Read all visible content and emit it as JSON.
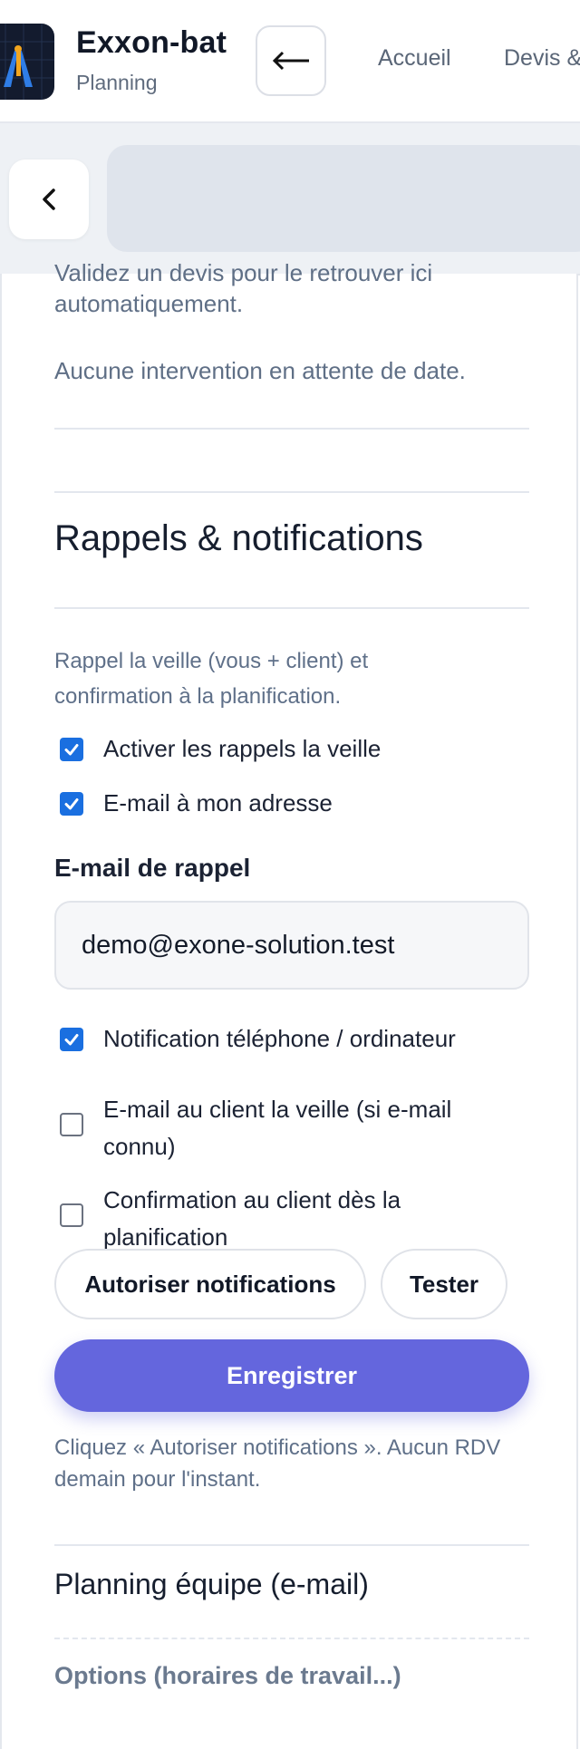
{
  "header": {
    "brand_name": "Exxon-bat",
    "brand_sub": "Planning",
    "back_glyph": "←",
    "nav": [
      "Accueil",
      "Devis &"
    ]
  },
  "subbar": {
    "back_glyph": "‹"
  },
  "pending": {
    "cut_text": "Validez un devis pour le retrouver ici",
    "line2": "automatiquement.",
    "empty_text": "Aucune intervention en attente de date."
  },
  "reminders": {
    "title": "Rappels & notifications",
    "description": "Rappel la veille (vous + client) et confirmation à la planification.",
    "options": [
      {
        "label": "Activer les rappels la veille",
        "checked": true
      },
      {
        "label": "E-mail à mon adresse",
        "checked": true
      }
    ],
    "email_label": "E-mail de rappel",
    "email_value": "demo@exone-solution.test",
    "options2": [
      {
        "label": "Notification téléphone / ordinateur",
        "checked": true
      },
      {
        "label": "E-mail au client la veille (si e-mail connu)",
        "checked": false
      },
      {
        "label": "Confirmation au client dès la planification",
        "checked": false
      }
    ],
    "allow_button": "Autoriser notifications",
    "test_button": "Tester",
    "save_button": "Enregistrer",
    "helper": "Cliquez « Autoriser notifications ». Aucun RDV demain pour l'instant."
  },
  "team": {
    "title": "Planning équipe (e-mail)",
    "options_link": "Options (horaires de travail...)"
  },
  "colors": {
    "accent": "#6466dd",
    "checkbox": "#1a6fe0",
    "muted": "#5f7089"
  }
}
